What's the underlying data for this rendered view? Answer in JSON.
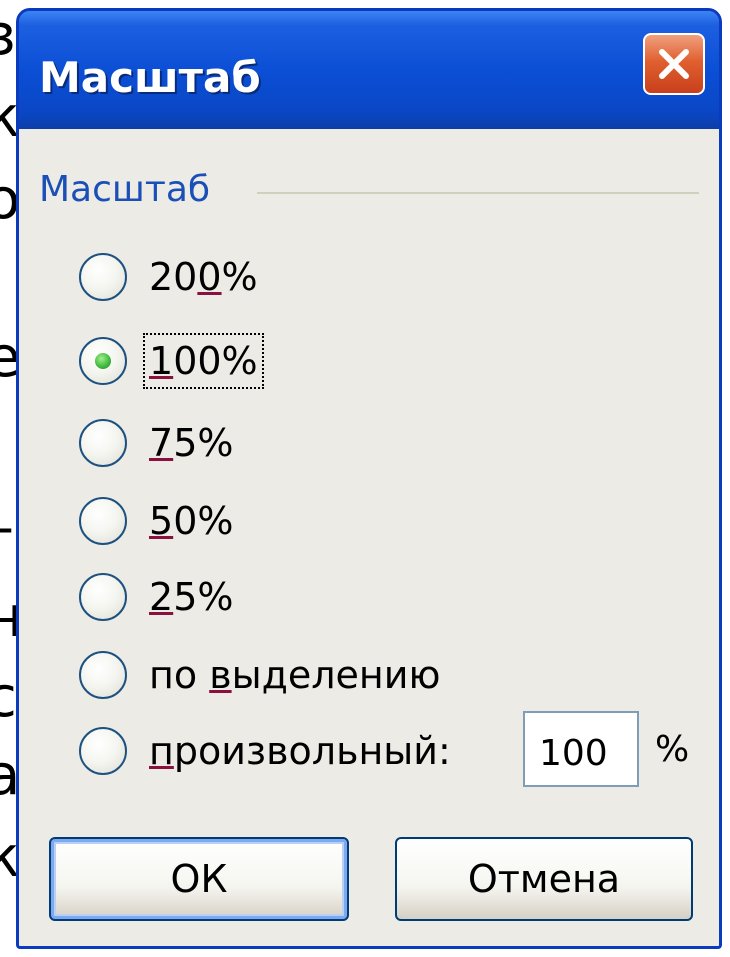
{
  "window": {
    "title": "Масштаб",
    "close_icon": "close-icon"
  },
  "group": {
    "label": "Масштаб"
  },
  "options": [
    {
      "pre": "20",
      "accel": "0",
      "post": "%",
      "selected": false
    },
    {
      "pre": "",
      "accel": "1",
      "post": "00%",
      "selected": true
    },
    {
      "pre": "",
      "accel": "7",
      "post": "5%",
      "selected": false
    },
    {
      "pre": "",
      "accel": "5",
      "post": "0%",
      "selected": false
    },
    {
      "pre": "",
      "accel": "2",
      "post": "5%",
      "selected": false
    },
    {
      "pre": "по ",
      "accel": "в",
      "post": "ыделению",
      "selected": false
    },
    {
      "pre": "",
      "accel": "п",
      "post": "роизвольный:",
      "selected": false
    }
  ],
  "custom": {
    "value": "100",
    "unit": "%"
  },
  "buttons": {
    "ok": "ОК",
    "cancel": "Отмена"
  },
  "background_fragments": [
    "з",
    "к",
    "о",
    "е",
    "–",
    "н",
    "с",
    "а",
    "к"
  ],
  "colors": {
    "title_bar": "#0a47c6",
    "group_label": "#1a4fb8",
    "close_button": "#e06030",
    "selected_dot": "#3db53d"
  }
}
